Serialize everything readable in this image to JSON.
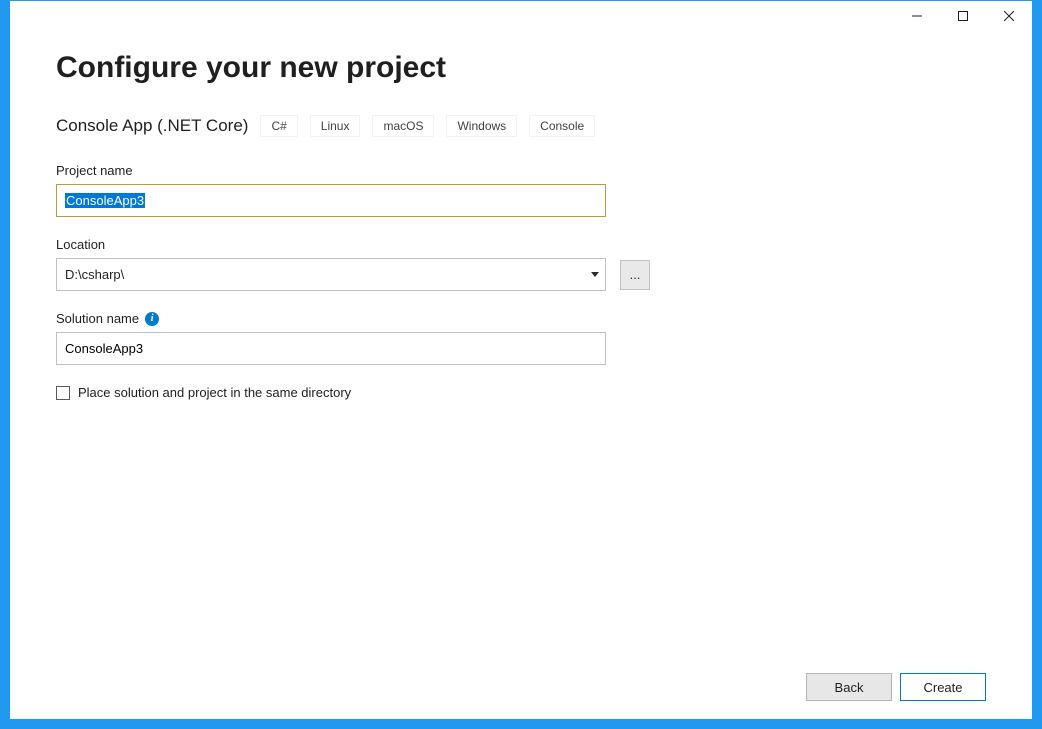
{
  "titlebar": {
    "minimize": "–",
    "maximize": "▢",
    "close": "✕"
  },
  "header": {
    "title": "Configure your new project",
    "template_name": "Console App (.NET Core)",
    "tags": [
      "C#",
      "Linux",
      "macOS",
      "Windows",
      "Console"
    ]
  },
  "fields": {
    "project_name_label": "Project name",
    "project_name_value": "ConsoleApp3",
    "location_label": "Location",
    "location_value": "D:\\csharp\\",
    "browse_label": "...",
    "solution_name_label": "Solution name",
    "solution_name_value": "ConsoleApp3",
    "same_dir_label": "Place solution and project in the same directory"
  },
  "footer": {
    "back_label": "Back",
    "create_label": "Create"
  }
}
